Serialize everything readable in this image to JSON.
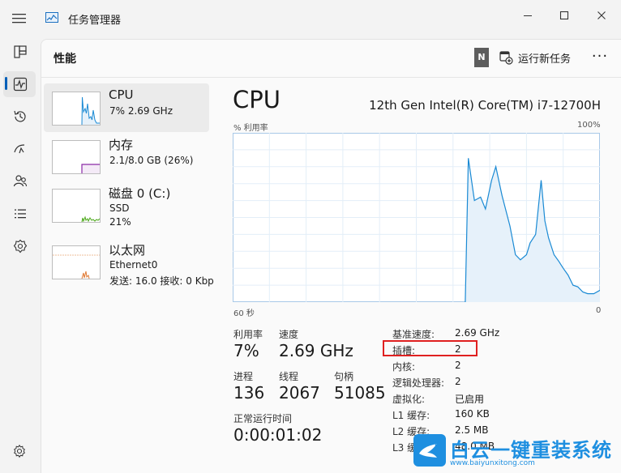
{
  "window": {
    "title": "任务管理器",
    "minimize": "—",
    "maximize": "☐",
    "close": "✕"
  },
  "rail": {
    "items": [
      "hamburger-icon",
      "processes-icon",
      "performance-icon",
      "app-history-icon",
      "startup-icon",
      "users-icon",
      "details-icon",
      "services-icon",
      "settings-icon"
    ]
  },
  "header": {
    "page_title": "性能",
    "n_badge": "N",
    "run_task_label": "运行新任务",
    "more": "···"
  },
  "devices": [
    {
      "name": "CPU",
      "line1": "7% 2.69 GHz",
      "line2": ""
    },
    {
      "name": "内存",
      "line1": "2.1/8.0 GB (26%)",
      "line2": ""
    },
    {
      "name": "磁盘 0 (C:)",
      "line1": "SSD",
      "line2": "21%"
    },
    {
      "name": "以太网",
      "line1": "Ethernet0",
      "line2": "发送: 16.0 接收: 0 Kbp"
    }
  ],
  "detail": {
    "title": "CPU",
    "model": "12th Gen Intel(R) Core(TM) i7-12700H",
    "y_label": "% 利用率",
    "y_max": "100%",
    "x_left": "60 秒",
    "x_right": "0",
    "stats": {
      "utilization_label": "利用率",
      "utilization_value": "7%",
      "speed_label": "速度",
      "speed_value": "2.69 GHz",
      "processes_label": "进程",
      "processes_value": "136",
      "threads_label": "线程",
      "threads_value": "2067",
      "handles_label": "句柄",
      "handles_value": "51085",
      "uptime_label": "正常运行时间",
      "uptime_value": "0:00:01:02"
    },
    "specs": [
      {
        "label": "基准速度:",
        "value": "2.69 GHz"
      },
      {
        "label": "插槽:",
        "value": "2"
      },
      {
        "label": "内核:",
        "value": "2"
      },
      {
        "label": "逻辑处理器:",
        "value": "2"
      },
      {
        "label": "虚拟化:",
        "value": "已启用"
      },
      {
        "label": "L1 缓存:",
        "value": "160 KB"
      },
      {
        "label": "L2 缓存:",
        "value": "2.5 MB"
      },
      {
        "label": "L3 缓",
        "value": "48.0 MB"
      }
    ]
  },
  "watermark": {
    "cn": "白云一键重装系统",
    "url": "www.baiyunxitong.com"
  },
  "colors": {
    "accent": "#005fb8",
    "cpu_line": "#1a8ad4",
    "cpu_fill": "#e6f1fa",
    "memory_line": "#8b2aa6",
    "disk_line": "#4ca81a",
    "net_line": "#e07a34",
    "highlight": "#e02020"
  },
  "chart_data": {
    "type": "area",
    "xlabel": "60 秒",
    "ylabel": "% 利用率",
    "ylim": [
      0,
      100
    ],
    "x_range": [
      0,
      60
    ],
    "grid": true,
    "series": [
      {
        "values": [
          [
            0,
            0
          ],
          [
            1,
            0
          ],
          [
            2,
            0
          ],
          [
            3,
            0
          ],
          [
            4,
            0
          ],
          [
            5,
            0
          ],
          [
            6,
            0
          ],
          [
            7,
            0
          ],
          [
            8,
            0
          ],
          [
            9,
            0
          ],
          [
            10,
            0
          ],
          [
            11,
            0
          ],
          [
            12,
            0
          ],
          [
            13,
            0
          ],
          [
            14,
            0
          ],
          [
            15,
            0
          ],
          [
            16,
            0
          ],
          [
            17,
            0
          ],
          [
            18,
            0
          ],
          [
            19,
            0
          ],
          [
            20,
            0
          ],
          [
            21,
            0
          ],
          [
            22,
            0
          ],
          [
            23,
            0
          ],
          [
            24,
            0
          ],
          [
            25,
            0
          ],
          [
            26,
            0
          ],
          [
            27,
            0
          ],
          [
            28,
            0
          ],
          [
            29,
            0
          ],
          [
            30,
            0
          ],
          [
            31,
            0
          ],
          [
            32,
            0
          ],
          [
            33,
            0
          ],
          [
            34,
            0
          ],
          [
            35,
            0
          ],
          [
            36,
            0
          ],
          [
            37,
            0
          ],
          [
            38,
            0
          ],
          [
            38.5,
            85
          ],
          [
            39.5,
            60
          ],
          [
            40.5,
            62
          ],
          [
            41.3,
            55
          ],
          [
            42.3,
            72
          ],
          [
            43,
            80
          ],
          [
            44,
            63
          ],
          [
            45.3,
            45
          ],
          [
            46.2,
            28
          ],
          [
            47,
            25
          ],
          [
            48,
            28
          ],
          [
            48.6,
            35
          ],
          [
            49.5,
            40
          ],
          [
            50.4,
            72
          ],
          [
            51,
            48
          ],
          [
            51.6,
            38
          ],
          [
            52.5,
            28
          ],
          [
            53.3,
            24
          ],
          [
            54,
            20
          ],
          [
            54.8,
            16
          ],
          [
            55.6,
            10
          ],
          [
            56.4,
            9
          ],
          [
            57.2,
            6
          ],
          [
            58,
            5
          ],
          [
            59,
            5
          ],
          [
            60,
            7
          ]
        ]
      }
    ]
  }
}
